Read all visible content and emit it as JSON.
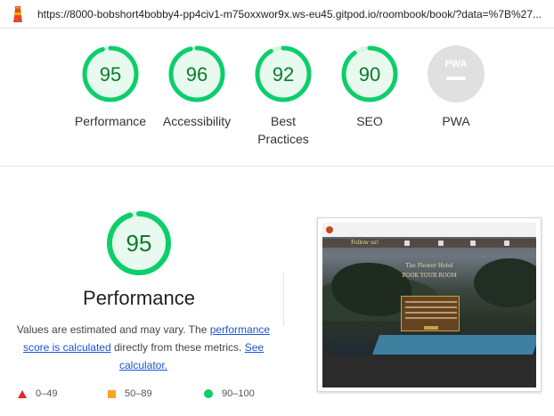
{
  "url": "https://8000-bobshort4bobby4-pp4civ1-m75oxxwor9x.ws-eu45.gitpod.io/roombook/book/?data=%7B%27...",
  "categories": [
    {
      "label": "Performance",
      "score": "95",
      "value": 95
    },
    {
      "label": "Accessibility",
      "score": "96",
      "value": 96
    },
    {
      "label": "Best Practices",
      "score": "92",
      "value": 92
    },
    {
      "label": "SEO",
      "score": "90",
      "value": 90
    },
    {
      "label": "PWA",
      "score": "PWA",
      "value": null
    }
  ],
  "detail": {
    "score": "95",
    "value": 95,
    "title": "Performance",
    "desc_prefix": "Values are estimated and may vary. The ",
    "desc_link1": "performance score is calculated",
    "desc_middle": " directly from these metrics. ",
    "desc_link2": "See calculator."
  },
  "legend": {
    "fail": "0–49",
    "average": "50–89",
    "pass": "90–100"
  },
  "screenshot": {
    "follow": "Follow us!",
    "hotel_name": "The Flower Hotel",
    "heading": "BOOK YOUR ROOM"
  },
  "colors": {
    "pass": "#0cce6b",
    "pass_text": "#0c7c2a",
    "average": "#f5a623",
    "fail": "#ee2222",
    "pwa_gray": "#e0e0e0"
  }
}
